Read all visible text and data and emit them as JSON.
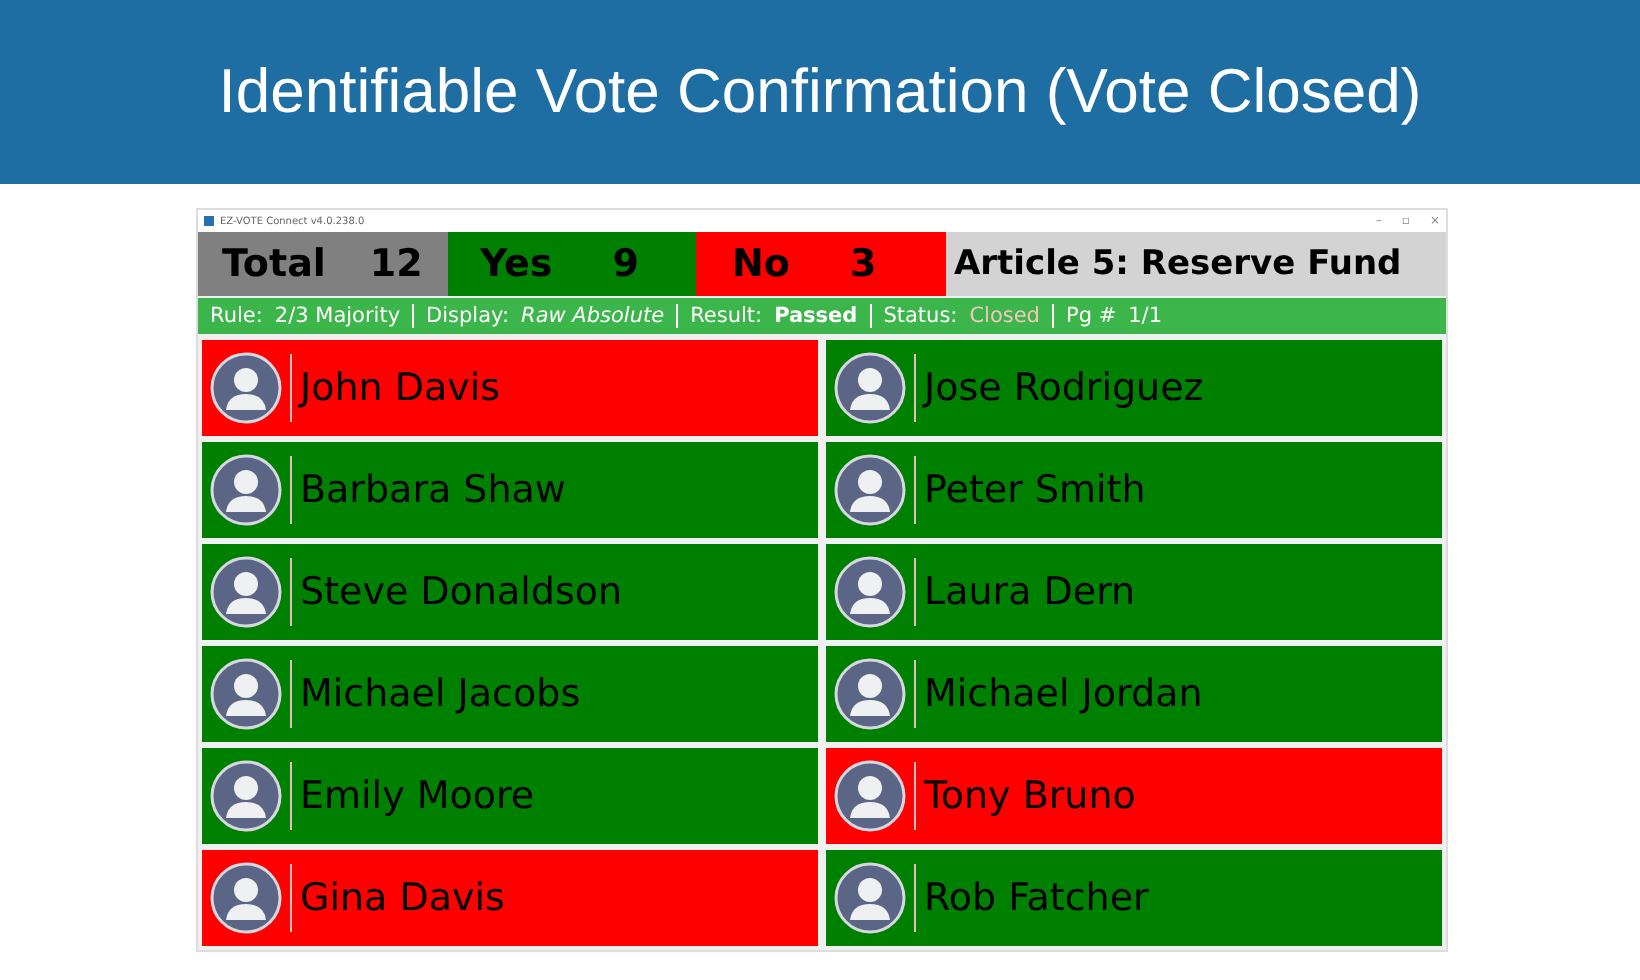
{
  "slide_title": "Identifiable Vote Confirmation (Vote Closed)",
  "window": {
    "title": "EZ-VOTE Connect v4.0.238.0",
    "controls": [
      "–",
      "▫",
      "×"
    ]
  },
  "summary": [
    {
      "kind": "total",
      "label": "Total",
      "value": "12"
    },
    {
      "kind": "yes",
      "label": "Yes",
      "value": "9"
    },
    {
      "kind": "no",
      "label": "No",
      "value": "3"
    },
    {
      "kind": "title",
      "label": "Article 5: Reserve Fund"
    }
  ],
  "status_bar": [
    {
      "label": "Rule:",
      "value": "2/3 Majority",
      "kind": "plain"
    },
    {
      "label": "Display:",
      "value": "Raw Absolute",
      "kind": "italic"
    },
    {
      "label": "Result:",
      "value": "Passed",
      "kind": "bold"
    },
    {
      "label": "Status:",
      "value": "Closed",
      "kind": "faint"
    },
    {
      "label": "Pg #",
      "value": "1/1",
      "kind": "plain"
    }
  ],
  "voters": [
    {
      "name": "John Davis",
      "color": "#ff0000"
    },
    {
      "name": "Jose Rodriguez",
      "color": "#008000"
    },
    {
      "name": "Barbara Shaw",
      "color": "#008000"
    },
    {
      "name": "Peter Smith",
      "color": "#008000"
    },
    {
      "name": "Steve Donaldson",
      "color": "#008000"
    },
    {
      "name": "Laura Dern",
      "color": "#008000"
    },
    {
      "name": "Michael Jacobs",
      "color": "#008000"
    },
    {
      "name": "Michael Jordan",
      "color": "#008000"
    },
    {
      "name": "Emily Moore",
      "color": "#008000"
    },
    {
      "name": "Tony Bruno",
      "color": "#ff0000"
    },
    {
      "name": "Gina Davis",
      "color": "#ff0000"
    },
    {
      "name": "Rob Fatcher",
      "color": "#008000"
    }
  ]
}
